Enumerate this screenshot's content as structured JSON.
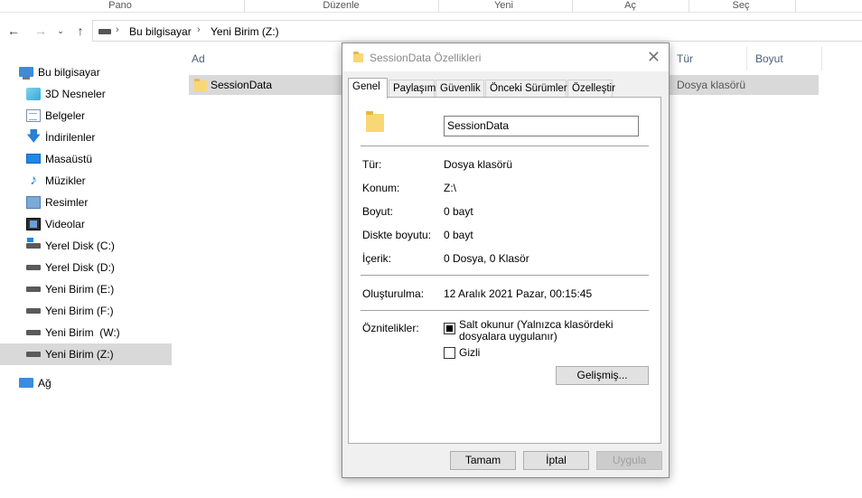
{
  "ribbon": {
    "groups": [
      "Pano",
      "Düzenle",
      "Yeni",
      "Aç",
      "Seç"
    ]
  },
  "address": {
    "crumbs": [
      "Bu bilgisayar",
      "Yeni Birim (Z:)"
    ]
  },
  "sidebar": {
    "items": [
      {
        "label": "Bu bilgisayar",
        "icon": "computer-icon"
      },
      {
        "label": "3D Nesneler",
        "icon": "3d-objects-icon"
      },
      {
        "label": "Belgeler",
        "icon": "documents-icon"
      },
      {
        "label": "İndirilenler",
        "icon": "downloads-icon"
      },
      {
        "label": "Masaüstü",
        "icon": "desktop-icon"
      },
      {
        "label": "Müzikler",
        "icon": "music-icon"
      },
      {
        "label": "Resimler",
        "icon": "pictures-icon"
      },
      {
        "label": "Videolar",
        "icon": "videos-icon"
      },
      {
        "label": "Yerel Disk (C:)",
        "icon": "system-drive-icon"
      },
      {
        "label": "Yerel Disk (D:)",
        "icon": "drive-icon"
      },
      {
        "label": "Yeni Birim (E:)",
        "icon": "drive-icon"
      },
      {
        "label": "Yeni Birim (F:)",
        "icon": "drive-icon"
      },
      {
        "label": "Yeni Birim  (W:)",
        "icon": "drive-icon"
      },
      {
        "label": "Yeni Birim (Z:)",
        "icon": "drive-icon",
        "selected": true
      },
      {
        "label": "Ağ",
        "icon": "network-icon"
      }
    ]
  },
  "filelist": {
    "columns": [
      "Ad",
      "Tür",
      "Boyut"
    ],
    "rows": [
      {
        "name": "SessionData",
        "type": "Dosya klasörü"
      }
    ]
  },
  "dialog": {
    "title": "SessionData Özellikleri",
    "close_glyph": "✕",
    "tabs": [
      "Genel",
      "Paylaşım",
      "Güvenlik",
      "Önceki Sürümler",
      "Özelleştir"
    ],
    "name_value": "SessionData",
    "props": {
      "type_label": "Tür:",
      "type_value": "Dosya klasörü",
      "location_label": "Konum:",
      "location_value": "Z:\\",
      "size_label": "Boyut:",
      "size_value": "0 bayt",
      "disk_size_label": "Diskte boyutu:",
      "disk_size_value": "0 bayt",
      "contents_label": "İçerik:",
      "contents_value": "0 Dosya, 0 Klasör",
      "created_label": "Oluşturulma:",
      "created_value": "12 Aralık 2021 Pazar, 00:15:45",
      "attributes_label": "Öznitelikler:",
      "readonly_label": "Salt okunur (Yalnızca klasördeki dosyalara uygulanır)",
      "hidden_label": "Gizli",
      "advanced_button": "Gelişmiş..."
    },
    "buttons": {
      "ok": "Tamam",
      "cancel": "İptal",
      "apply": "Uygula"
    }
  }
}
